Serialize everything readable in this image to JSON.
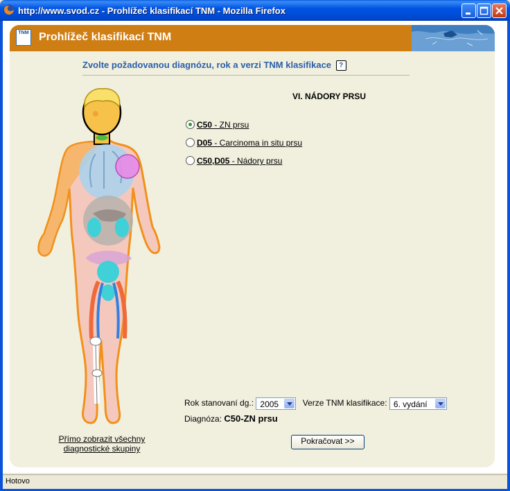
{
  "window": {
    "title": "http://www.svod.cz - Prohlížeč klasifikací TNM - Mozilla Firefox"
  },
  "header": {
    "logo_text": "TNM",
    "title": "Prohlížeč klasifikací TNM"
  },
  "instruction": {
    "text": "Zvolte požadovanou diagnózu, rok a verzi TNM klasifikace",
    "help_icon": "?"
  },
  "section": {
    "title": "VI. NÁDORY PRSU"
  },
  "diagnoses": [
    {
      "code": "C50",
      "label": " - ZN prsu",
      "checked": true
    },
    {
      "code": "D05",
      "label": " - Carcinoma in situ prsu",
      "checked": false
    },
    {
      "code": "C50,D05",
      "label": " - Nádory prsu",
      "checked": false
    }
  ],
  "form": {
    "year_label": "Rok stanovaní dg.:",
    "year_value": "2005",
    "version_label": "Verze TNM klasifikace:",
    "version_value": "6. vydání",
    "diagnosis_label": "Diagnóza:",
    "diagnosis_value": "C50-ZN prsu",
    "continue_button": "Pokračovat >>"
  },
  "links": {
    "show_all": "Přímo zobrazit všechny diagnostické skupiny"
  },
  "statusbar": {
    "text": "Hotovo"
  },
  "colors": {
    "accent_orange": "#cf7e14",
    "instruction_blue": "#2a5ea8",
    "panel_bg": "#f1f0df"
  }
}
